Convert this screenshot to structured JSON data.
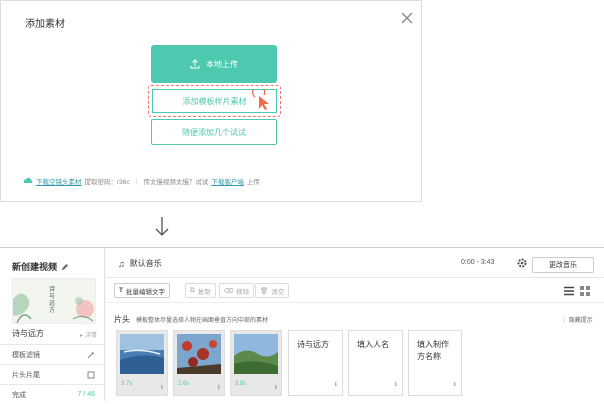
{
  "dialog": {
    "title": "添加素材",
    "upload_label": "本地上传",
    "template_label": "添加模板样片素材",
    "try_label": "随便添加几个试试",
    "footer": {
      "download_link": "下载空镜头素材",
      "code_text": "提取密码：r36c",
      "hint_text": "传太慢视频太慢？试试",
      "client_link": "下载客户端",
      "upload_text": "上传"
    }
  },
  "editor": {
    "project_title": "新创建视频",
    "thumb_text": "诗与远方",
    "template_name": "诗与远方",
    "detail_label": "详情",
    "rows": [
      {
        "label": "模板滤镜",
        "value": ""
      },
      {
        "label": "片头片尾",
        "value": ""
      },
      {
        "label": "完成",
        "value": "7 / 46"
      }
    ],
    "music_name": "默认音乐",
    "time_range": "0:00 - 3:43",
    "change_music": "更改音乐",
    "toolbar": {
      "batch_edit": "批量编辑文字",
      "copy": "复制",
      "move": "移除",
      "clear": "清空"
    },
    "section_label": "片头",
    "section_tip": "模板整体尽量选择人物在画面垂直方向中部的素材",
    "hide_tip": "隐藏提示",
    "clips": [
      {
        "duration": "3.7s"
      },
      {
        "duration": "2.6s"
      },
      {
        "duration": "3.8s"
      }
    ],
    "text_cards": [
      {
        "text": "诗与远方"
      },
      {
        "text": "填入人名"
      },
      {
        "text": "填入制作方名称"
      }
    ],
    "info_glyph": "ℹ"
  },
  "colors": {
    "accent": "#4ec9b0",
    "dashed": "#f07868",
    "cursor": "#f06a4f"
  }
}
